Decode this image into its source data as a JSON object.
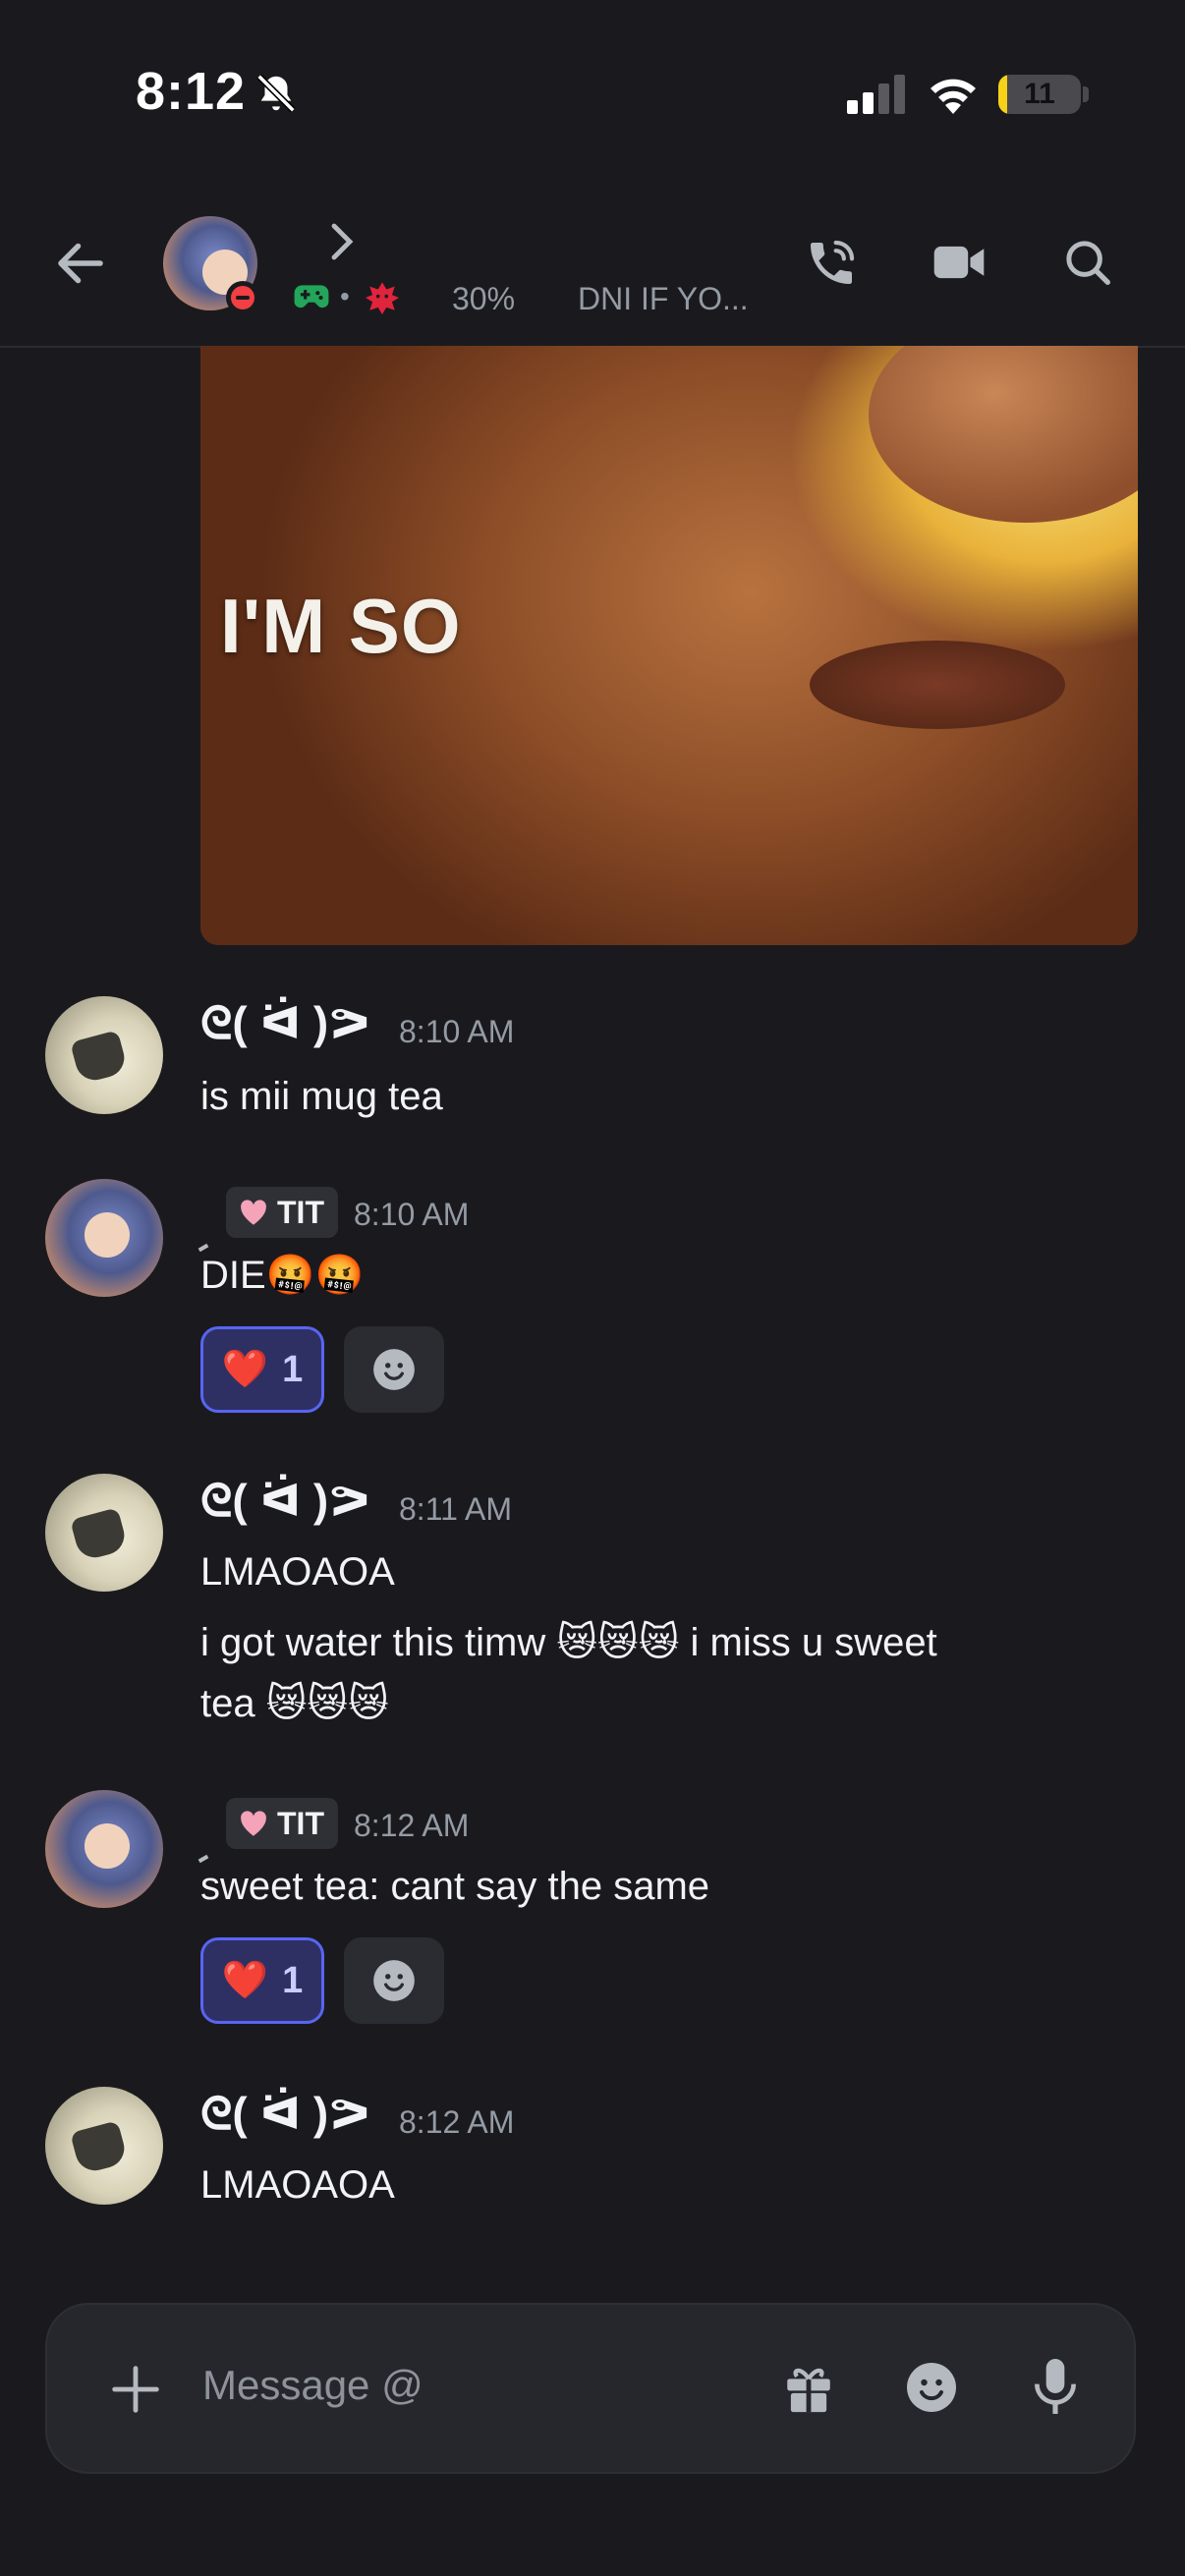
{
  "status_bar": {
    "time": "8:12",
    "battery": "11",
    "battery_level": 0.11
  },
  "header": {
    "percent": "30%",
    "status_text": "DNI IF YO..."
  },
  "media": {
    "caption": "I'M SO"
  },
  "messages": [
    {
      "author": "ᘓ( ᐛ )ᕗ",
      "time": "8:10 AM",
      "lines": [
        "is mii mug tea"
      ]
    },
    {
      "author": "",
      "tag": "TIT",
      "time": "8:10 AM",
      "lines": [
        "DIE🤬🤬"
      ],
      "reaction": {
        "emoji": "❤️",
        "count": "1"
      }
    },
    {
      "author": "ᘓ( ᐛ )ᕗ",
      "time": "8:11 AM",
      "lines": [
        "LMAOAOA",
        "i got water this timw 😿😿😿 i miss u sweet",
        "tea 😿😿😿"
      ]
    },
    {
      "author": "",
      "tag": "TIT",
      "time": "8:12 AM",
      "lines": [
        "sweet tea: cant say the same"
      ],
      "reaction": {
        "emoji": "❤️",
        "count": "1"
      }
    },
    {
      "author": "ᘓ( ᐛ )ᕗ",
      "time": "8:12 AM",
      "lines": [
        "LMAOAOA"
      ]
    }
  ],
  "composer": {
    "placeholder": "Message @"
  },
  "colors": {
    "accent": "#5865f2",
    "dnd": "#f23f43",
    "game": "#23a55a",
    "battery": "#f7d117"
  },
  "icons": [
    "back-arrow-icon",
    "chevron-right-icon",
    "gamepad-icon",
    "angry-face-icon",
    "phone-call-icon",
    "video-camera-icon",
    "search-icon",
    "plus-icon",
    "gift-icon",
    "emoji-icon",
    "microphone-icon",
    "bell-muted-icon",
    "cellular-signal-icon",
    "wifi-icon",
    "heart-tag-icon"
  ]
}
